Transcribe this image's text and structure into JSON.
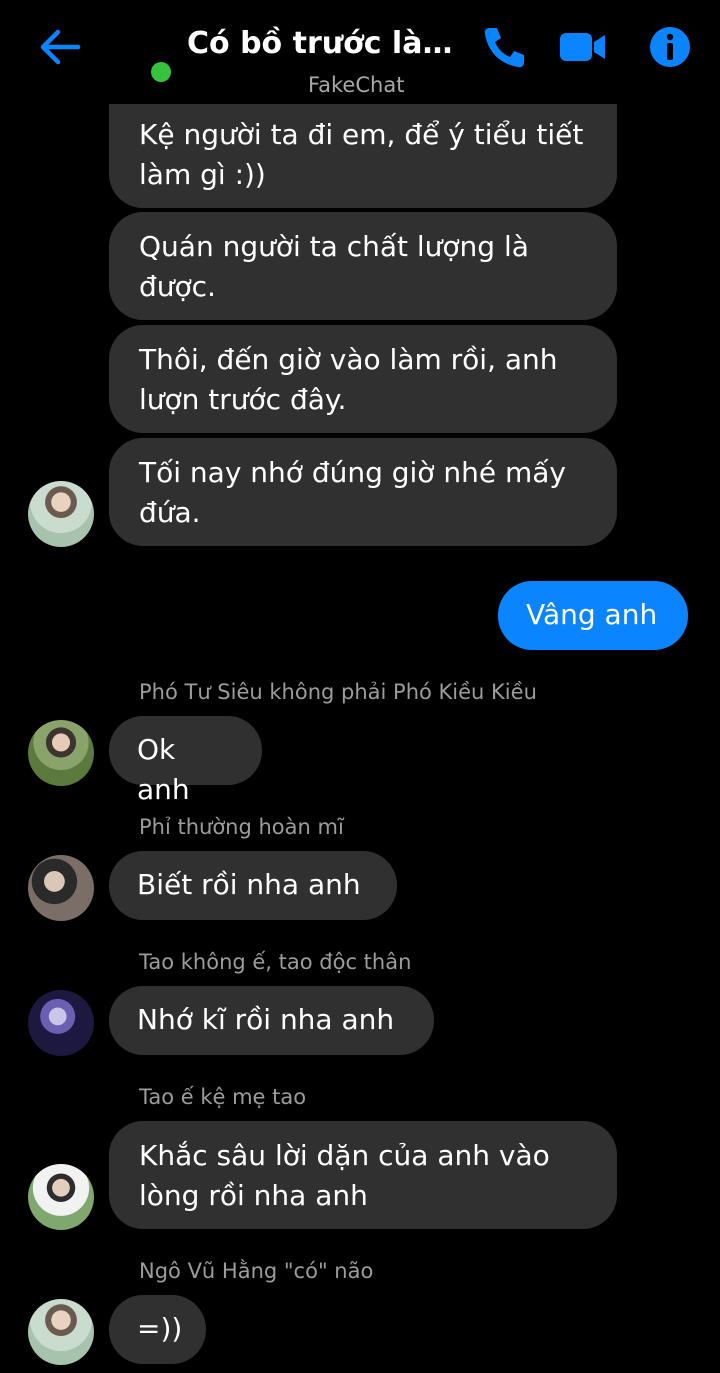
{
  "header": {
    "title": "Có bồ trước làm...",
    "subtitle": "FakeChat",
    "accent": "#0a84ff",
    "online_color": "#37c43d"
  },
  "messages": [
    {
      "text": "Kệ người ta đi em, để ý tiểu tiết làm gì :))"
    },
    {
      "text": "Quán người ta chất lượng là được."
    },
    {
      "text": "Thôi, đến giờ vào làm rồi, anh lượn trước đây."
    },
    {
      "text": "Tối nay nhớ đúng giờ nhé mấy đứa."
    },
    {
      "text": "Vâng anh"
    },
    {
      "sender": "Phó Tư Siêu không phải Phó Kiều Kiều",
      "text": "Ok anh"
    },
    {
      "sender": "Phỉ thường hoàn mĩ",
      "text": "Biết rồi nha anh"
    },
    {
      "sender": "Tao không ế, tao độc thân",
      "text": "Nhớ kĩ rồi nha anh"
    },
    {
      "sender": "Tao ế kệ mẹ tao",
      "text": "Khắc sâu lời dặn của anh vào lòng rồi nha anh"
    },
    {
      "sender": "Ngô Vũ Hằng \"có\" não",
      "text": "=))"
    }
  ]
}
